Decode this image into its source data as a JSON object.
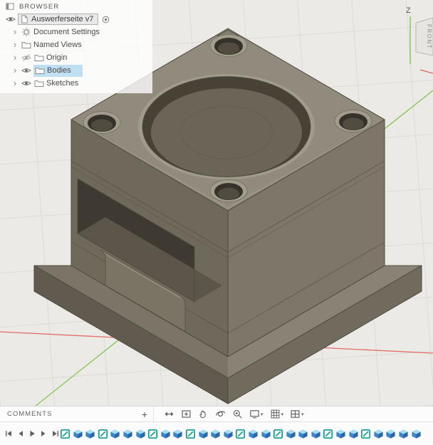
{
  "browser": {
    "header": "BROWSER",
    "chevron": "›",
    "items": [
      {
        "label": "Auswerferseite v7"
      },
      {
        "label": "Document Settings"
      },
      {
        "label": "Named Views"
      },
      {
        "label": "Origin"
      },
      {
        "label": "Bodies"
      },
      {
        "label": "Sketches"
      }
    ]
  },
  "viewcube": {
    "z_label": "Z",
    "face_label": "FRONT"
  },
  "bottom_bar": {
    "comments_label": "COMMENTS",
    "add_button": "+"
  },
  "nav_toolbar": {
    "items": [
      {
        "icon": "pan"
      },
      {
        "icon": "fit"
      },
      {
        "icon": "hand"
      },
      {
        "icon": "orbit"
      },
      {
        "icon": "zoom"
      },
      {
        "icon": "display-settings",
        "caret": true
      },
      {
        "icon": "grid-snaps",
        "caret": true
      },
      {
        "icon": "viewports",
        "caret": true
      }
    ]
  },
  "timeline": {
    "controls": [
      "skip-start",
      "step-back",
      "play",
      "step-forward",
      "skip-end"
    ],
    "features": [
      "sketch",
      "extrude",
      "extrude",
      "sketch",
      "extrude",
      "extrude",
      "extrude",
      "sketch",
      "extrude",
      "extrude",
      "sketch",
      "extrude",
      "extrude",
      "extrude",
      "sketch",
      "extrude",
      "extrude",
      "sketch",
      "extrude",
      "extrude",
      "extrude",
      "sketch",
      "extrude",
      "extrude",
      "sketch",
      "extrude",
      "extrude",
      "extrude",
      "extrude"
    ]
  },
  "colors": {
    "canvas_bg": "#ebeae7",
    "grid_line": "#dddbd7",
    "axis_red": "#e25f5a",
    "axis_green": "#7ac143",
    "model_top": "#918b7e",
    "model_left": "#6f695c",
    "model_right": "#7d7669",
    "model_base_top_left": "#7b7567",
    "model_base_top_right": "#898375",
    "model_base_left": "#615b4f",
    "model_base_right": "#716b5e",
    "model_pocket_wall": "#474136",
    "model_pocket_floor": "#6b6557",
    "model_hole": "#36322b",
    "model_chamfer": "#a29c8d",
    "model_edge": "#4c473c",
    "model_window": "#3f3a31",
    "model_window_floor": "#5b554a",
    "selection_blue": "#bfdff2",
    "sketch_teal": "#0e9c8d",
    "extrude_blue": "#3d87c9",
    "extrude_top": "#a5ddf3",
    "extrude_side": "#2a66a8"
  }
}
